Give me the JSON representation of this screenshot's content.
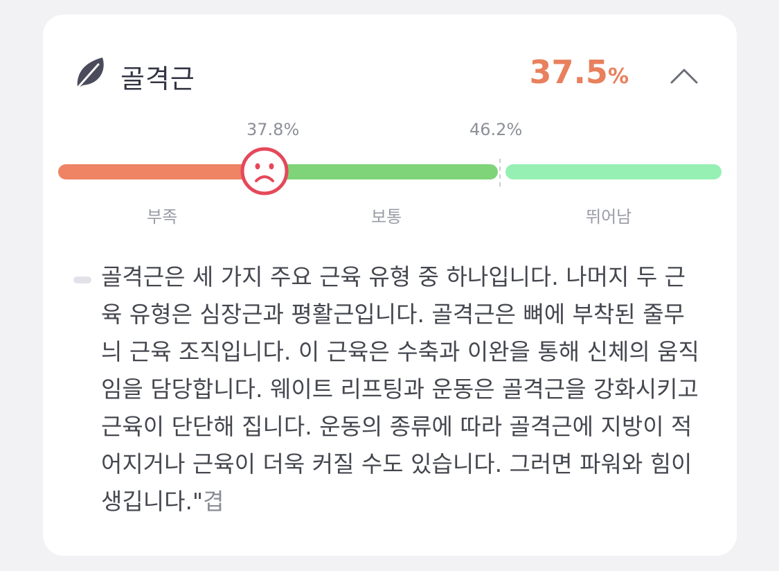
{
  "header": {
    "title": "골격근",
    "percentage_value": "37.5",
    "percentage_sign": "%",
    "icon": "leaf-icon",
    "toggle_icon": "chevron-up-icon"
  },
  "scale": {
    "current_value_percent": 37.5,
    "status_icon": "sad-face-icon",
    "thresholds": [
      "37.8%",
      "46.2%"
    ],
    "bands": [
      {
        "label": "부족",
        "color": "#ee8463"
      },
      {
        "label": "보통",
        "color": "#7fd47a"
      },
      {
        "label": "뛰어남",
        "color": "#96f0b4"
      }
    ]
  },
  "description": {
    "text": "골격근은 세 가지 주요 근육 유형 중 하나입니다. 나머지 두 근육 유형은 심장근과 평활근입니다. 골격근은 뼈에 부착된 줄무늬 근육 조직입니다. 이 근육은 수축과 이완을 통해 신체의 움직임을 담당합니다. 웨이트 리프팅과 운동은 골격근을 강화시키고 근육이 단단해 집니다. 운동의 종류에 따라 골격근에 지방이 적어지거나 근육이 더욱 커질 수도 있습니다. 그러면 파워와 힘이 생깁니다.\"",
    "trailing_link": "겹"
  },
  "colors": {
    "accent": "#e8805d",
    "sad_face": "#e5485a",
    "title_text": "#333544"
  }
}
